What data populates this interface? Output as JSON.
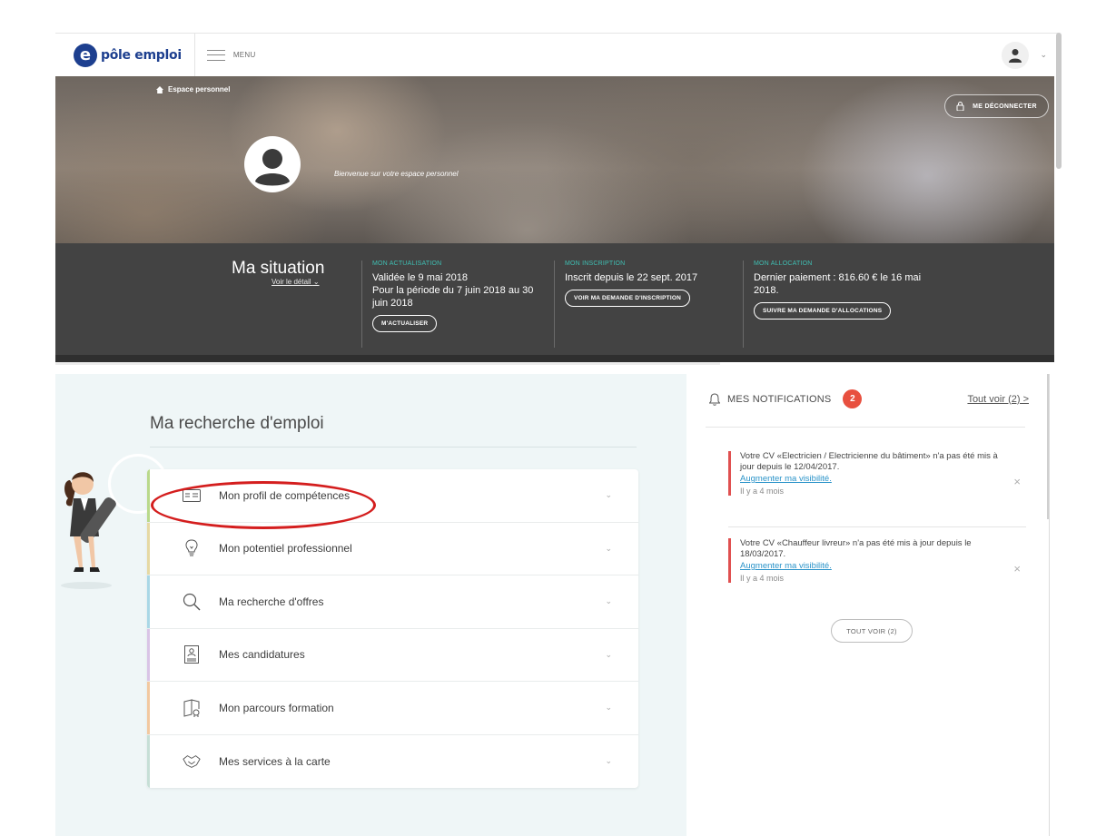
{
  "header": {
    "logo_mark": "e",
    "logo_text": "pôle emploi",
    "menu_label": "MENU"
  },
  "hero": {
    "breadcrumb": "Espace personnel",
    "logout_label": "ME DÉCONNECTER",
    "welcome_text": "Bienvenue sur votre espace personnel"
  },
  "situation": {
    "title": "Ma situation",
    "detail_link": "Voir le détail",
    "actualisation": {
      "label": "MON ACTUALISATION",
      "line1": "Validée le 9 mai 2018",
      "line2": "Pour la période du 7 juin 2018 au 30 juin 2018",
      "button": "M'ACTUALISER"
    },
    "inscription": {
      "label": "MON INSCRIPTION",
      "line1": "Inscrit depuis le 22 sept. 2017",
      "button": "VOIR MA DEMANDE D'INSCRIPTION"
    },
    "allocation": {
      "label": "MON ALLOCATION",
      "line1": "Dernier paiement : 816.60 € le 16 mai 2018.",
      "button": "SUIVRE MA DEMANDE D'ALLOCATIONS"
    }
  },
  "job_search": {
    "title": "Ma recherche d'emploi",
    "items": [
      {
        "label": "Mon profil de compétences",
        "icon": "id-card-icon",
        "accent": "#b9d98a"
      },
      {
        "label": "Mon potentiel professionnel",
        "icon": "lightbulb-icon",
        "accent": "#e6d9a3"
      },
      {
        "label": "Ma recherche d'offres",
        "icon": "search-icon",
        "accent": "#a9d7e6"
      },
      {
        "label": "Mes candidatures",
        "icon": "clipboard-icon",
        "accent": "#d9c4e6"
      },
      {
        "label": "Mon parcours formation",
        "icon": "training-icon",
        "accent": "#f2c8a0"
      },
      {
        "label": "Mes services à la carte",
        "icon": "handshake-icon",
        "accent": "#c6dfd6"
      }
    ]
  },
  "notifications": {
    "title": "MES NOTIFICATIONS",
    "count": "2",
    "see_all_link": "Tout voir (2) >",
    "items": [
      {
        "text": "Votre CV «Electricien / Electricienne du bâtiment» n'a pas été mis à jour depuis le 12/04/2017.",
        "link": "Augmenter ma visibilité.",
        "time": "Il y a 4 mois"
      },
      {
        "text": "Votre CV «Chauffeur livreur» n'a pas été mis à jour depuis le 18/03/2017.",
        "link": "Augmenter ma visibilité.",
        "time": "Il y a 4 mois"
      }
    ],
    "see_all_button": "TOUT VOIR (2)"
  },
  "colors": {
    "brand_blue": "#1d3f8f",
    "alert_red": "#e8503f",
    "highlight_red": "#d41e1e",
    "link_blue": "#2a93c9",
    "teal_label": "#3fbfb3"
  }
}
